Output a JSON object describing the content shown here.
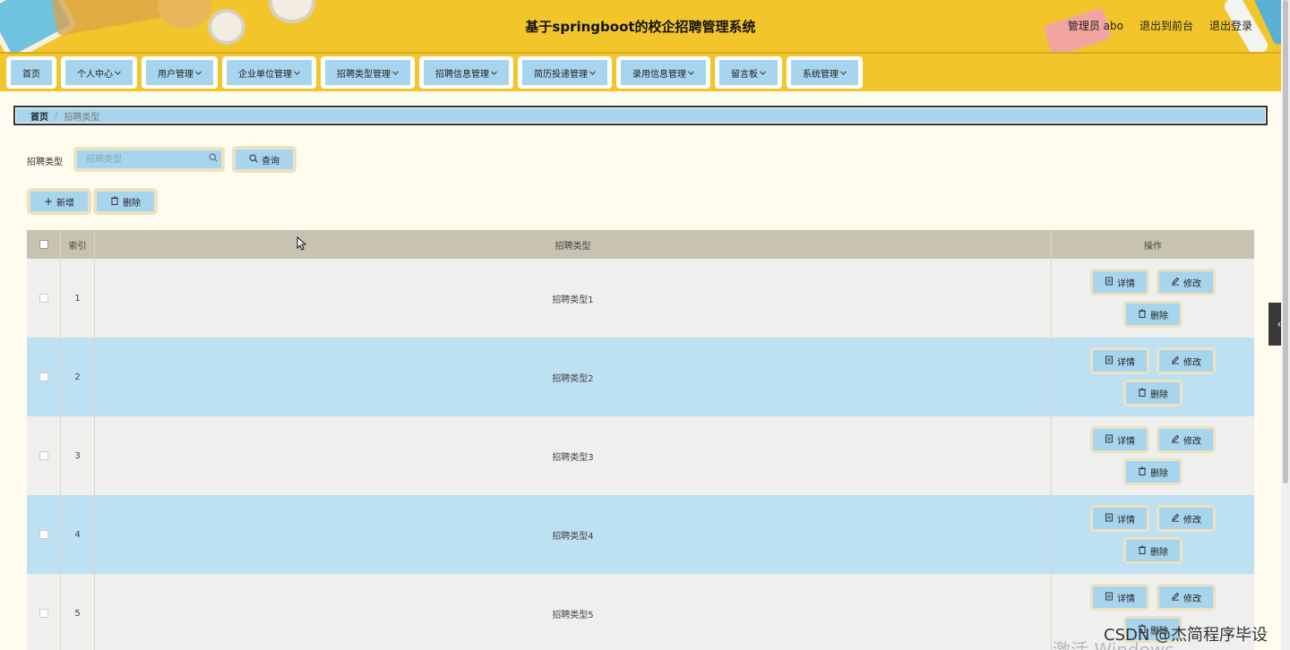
{
  "header": {
    "title": "基于springboot的校企招聘管理系统",
    "user_label": "管理员 abo",
    "back_front": "退出到前台",
    "logout": "退出登录"
  },
  "nav": {
    "items": [
      {
        "label": "首页",
        "dropdown": false
      },
      {
        "label": "个人中心",
        "dropdown": true
      },
      {
        "label": "用户管理",
        "dropdown": true
      },
      {
        "label": "企业单位管理",
        "dropdown": true
      },
      {
        "label": "招聘类型管理",
        "dropdown": true
      },
      {
        "label": "招聘信息管理",
        "dropdown": true
      },
      {
        "label": "简历投递管理",
        "dropdown": true
      },
      {
        "label": "录用信息管理",
        "dropdown": true
      },
      {
        "label": "留言板",
        "dropdown": true
      },
      {
        "label": "系统管理",
        "dropdown": true
      }
    ]
  },
  "breadcrumb": {
    "home": "首页",
    "sep": "/",
    "current": "招聘类型"
  },
  "search": {
    "label": "招聘类型",
    "placeholder": "招聘类型",
    "value": "",
    "button": "查询"
  },
  "toolbar": {
    "add": "新增",
    "delete": "删除"
  },
  "table": {
    "headers": {
      "index": "索引",
      "type": "招聘类型",
      "ops": "操作"
    },
    "rows": [
      {
        "index": "1",
        "type": "招聘类型1"
      },
      {
        "index": "2",
        "type": "招聘类型2"
      },
      {
        "index": "3",
        "type": "招聘类型3"
      },
      {
        "index": "4",
        "type": "招聘类型4"
      },
      {
        "index": "5",
        "type": "招聘类型5"
      }
    ],
    "ops": {
      "detail": "详情",
      "edit": "修改",
      "delete": "删除"
    }
  },
  "watermarks": {
    "windows": "激活 Windows",
    "csdn": "CSDN @杰简程序毕设"
  },
  "icons": {
    "search": "search-icon",
    "add": "plus-icon",
    "delete": "trash-icon",
    "detail": "document-icon",
    "edit": "pencil-icon",
    "toggle": "chevron-left-icon"
  }
}
